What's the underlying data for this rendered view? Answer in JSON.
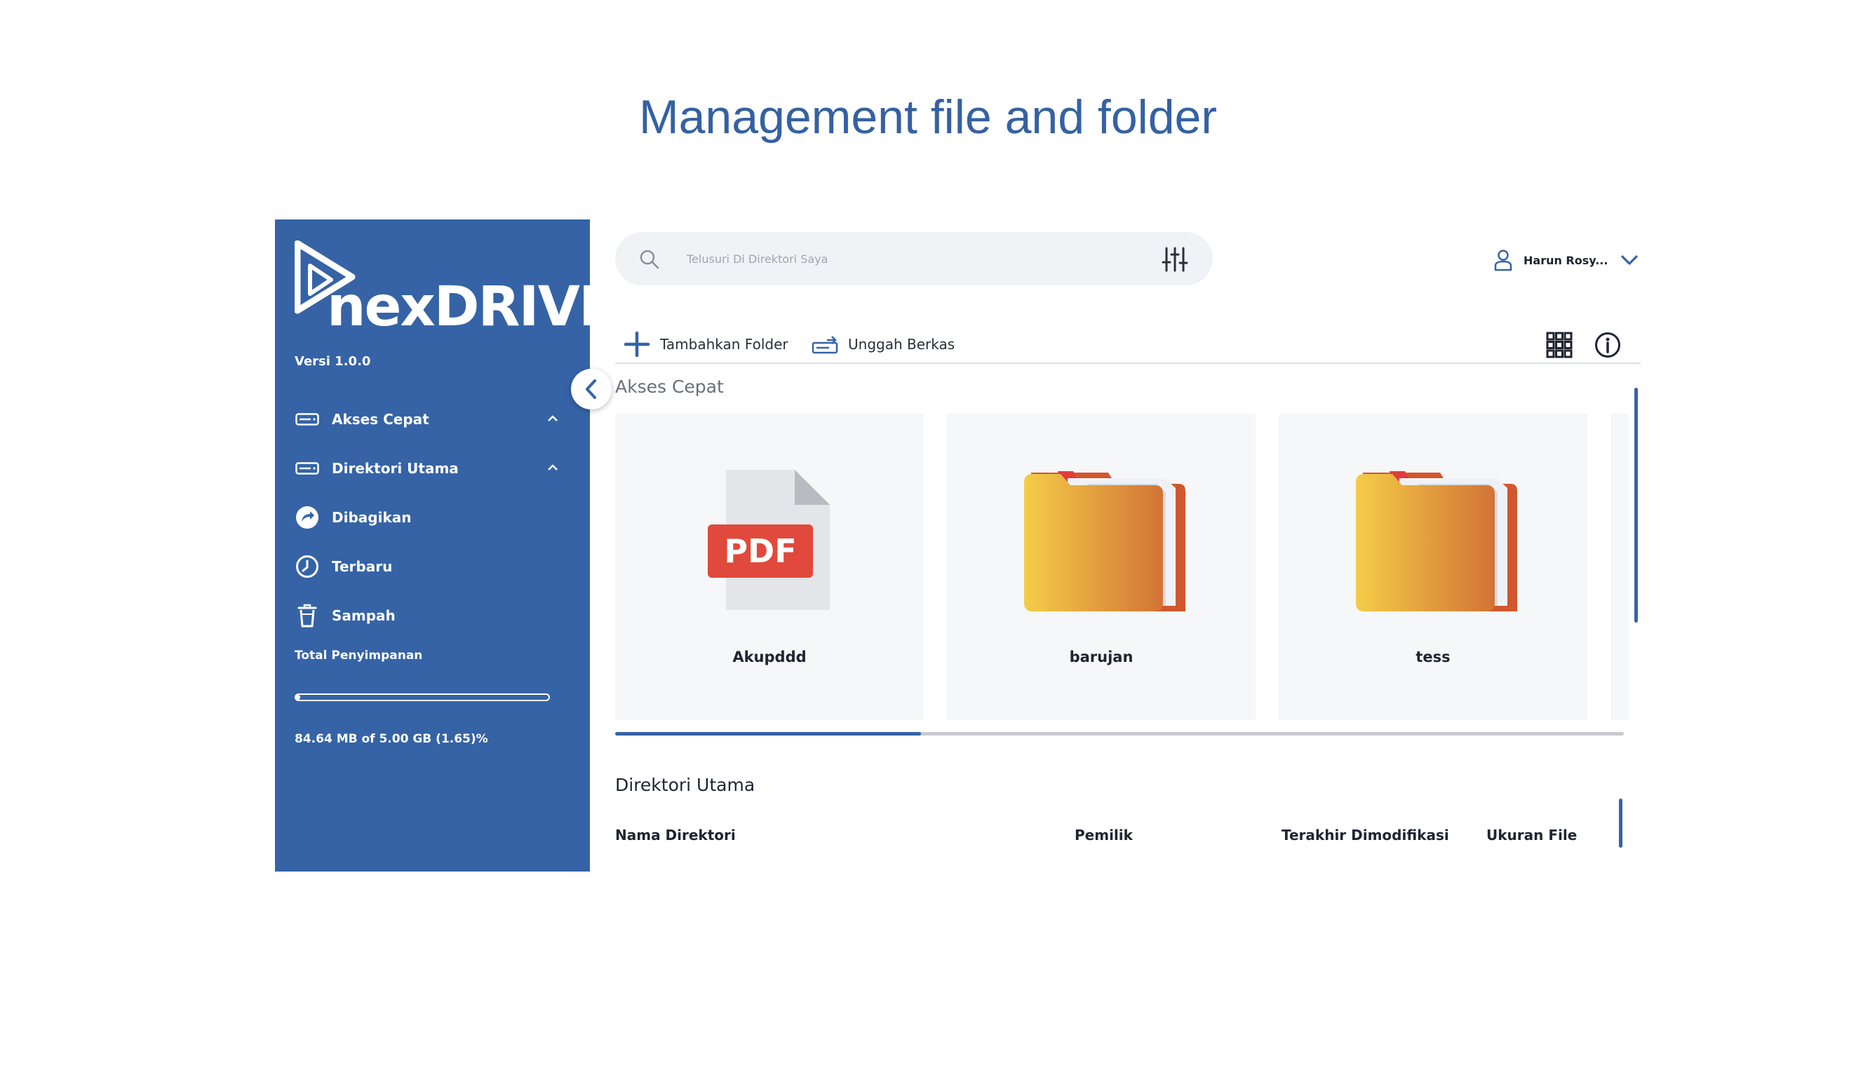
{
  "slide": {
    "title": "Management file and folder"
  },
  "sidebar": {
    "logo_text": "nexDRIVE",
    "version": "Versi 1.0.0",
    "items": [
      {
        "label": "Akses Cepat",
        "icon": "drive-icon",
        "expandable": true
      },
      {
        "label": "Direktori Utama",
        "icon": "drive-icon",
        "expandable": true
      },
      {
        "label": "Dibagikan",
        "icon": "share-icon",
        "expandable": false
      },
      {
        "label": "Terbaru",
        "icon": "clock-icon",
        "expandable": false
      },
      {
        "label": "Sampah",
        "icon": "trash-icon",
        "expandable": false
      }
    ],
    "storage_label": "Total Penyimpanan",
    "storage_text": "84.64 MB of 5.00 GB (1.65)%",
    "storage_fraction": 0.0165
  },
  "search": {
    "placeholder": "Telusuri Di Direktori Saya"
  },
  "user": {
    "name": "Harun Rosy..."
  },
  "toolbar": {
    "add_folder_label": "Tambahkan Folder",
    "upload_label": "Unggah Berkas"
  },
  "quick_access": {
    "title": "Akses Cepat",
    "items": [
      {
        "name": "Akupddd",
        "type": "pdf"
      },
      {
        "name": "barujan",
        "type": "folder"
      },
      {
        "name": "tess",
        "type": "folder"
      }
    ]
  },
  "main_directory": {
    "title": "Direktori Utama",
    "columns": [
      "Nama Direktori",
      "Pemilik",
      "Terakhir Dimodifikasi",
      "Ukuran File"
    ]
  },
  "colors": {
    "primary": "#3563a6",
    "card_bg": "#f6f7f9",
    "pdf_red": "#e0493b",
    "folder_yellow": "#f3c64a"
  }
}
